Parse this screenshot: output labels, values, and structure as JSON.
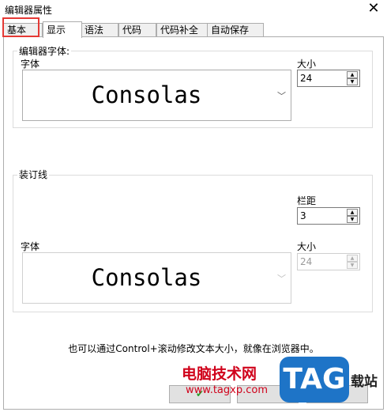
{
  "window": {
    "title": "编辑器属性",
    "close_glyph": "✕"
  },
  "tabs": [
    {
      "label": "基本",
      "active": false
    },
    {
      "label": "显示",
      "active": true
    },
    {
      "label": "语法",
      "active": false
    },
    {
      "label": "代码",
      "active": false
    },
    {
      "label": "代码补全",
      "active": false
    },
    {
      "label": "自动保存",
      "active": false
    }
  ],
  "editor_font": {
    "group_label": "编辑器字体:",
    "font_label": "字体",
    "font_value": "Consolas",
    "size_label": "大小",
    "size_value": "24"
  },
  "gutter": {
    "group_label": "装订线",
    "margin_label": "栏距",
    "margin_value": "3",
    "font_label": "字体",
    "font_value": "Consolas",
    "size_label": "大小",
    "size_value": "24"
  },
  "note": "也可以通过Control+滚动修改文本大小，就像在浏览器中。",
  "watermark": {
    "line1": "电脑技术网",
    "line2": "www.tagxp.com",
    "badge": "TAG",
    "side": "载站"
  },
  "colors": {
    "highlight": "#e53935",
    "watermark_red": "#d0021b",
    "badge_blue": "#1e74c7"
  }
}
